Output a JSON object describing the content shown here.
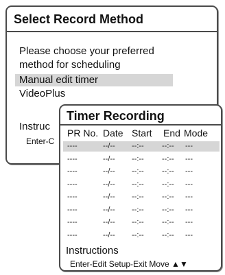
{
  "select_record": {
    "title": "Select Record Method",
    "message_line1": "Please choose your preferred",
    "message_line2": "method for scheduling",
    "options": [
      "Manual edit timer",
      "VideoPlus"
    ],
    "instructions_label": "Instruc",
    "instructions_keys": "Enter-C"
  },
  "timer_recording": {
    "title": "Timer Recording",
    "columns": [
      "PR No.",
      "Date",
      "Start",
      "End",
      "Mode"
    ],
    "rows": [
      [
        "----",
        "--/--",
        "--:--",
        "--:--",
        "---"
      ],
      [
        "----",
        "--/--",
        "--:--",
        "--:--",
        "---"
      ],
      [
        "----",
        "--/--",
        "--:--",
        "--:--",
        "---"
      ],
      [
        "----",
        "--/--",
        "--:--",
        "--:--",
        "---"
      ],
      [
        "----",
        "--/--",
        "--:--",
        "--:--",
        "---"
      ],
      [
        "----",
        "--/--",
        "--:--",
        "--:--",
        "---"
      ],
      [
        "----",
        "--/--",
        "--:--",
        "--:--",
        "---"
      ],
      [
        "----",
        "--/--",
        "--:--",
        "--:--",
        "---"
      ]
    ],
    "instructions_label": "Instructions",
    "instructions_keys": "Enter-Edit  Setup-Exit  Move ▲▼"
  }
}
